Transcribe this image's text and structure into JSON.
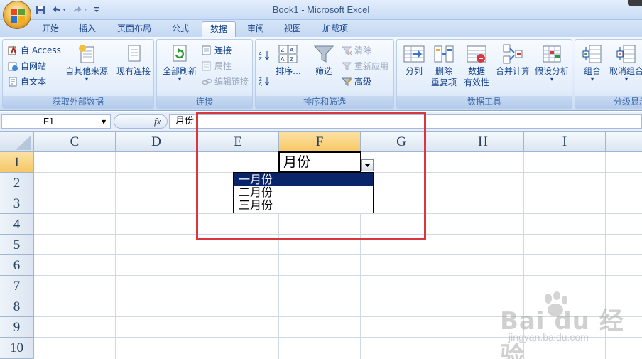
{
  "window": {
    "title": "Book1 - Microsoft Excel"
  },
  "tabs": [
    {
      "label": "开始",
      "active": false
    },
    {
      "label": "插入",
      "active": false
    },
    {
      "label": "页面布局",
      "active": false
    },
    {
      "label": "公式",
      "active": false
    },
    {
      "label": "数据",
      "active": true
    },
    {
      "label": "审阅",
      "active": false
    },
    {
      "label": "视图",
      "active": false
    },
    {
      "label": "加载项",
      "active": false
    }
  ],
  "ribbon": {
    "external_data": {
      "label": "获取外部数据",
      "access": "自 Access",
      "web": "自网站",
      "text": "自文本",
      "other": "自其他来源",
      "existing": "现有连接"
    },
    "connections": {
      "label": "连接",
      "refresh_all": "全部刷新",
      "connections": "连接",
      "properties": "属性",
      "edit_links": "编辑链接"
    },
    "sort_filter": {
      "label": "排序和筛选",
      "sort": "排序...",
      "filter": "筛选",
      "clear": "清除",
      "reapply": "重新应用",
      "advanced": "高级"
    },
    "data_tools": {
      "label": "数据工具",
      "text_to_columns": "分列",
      "remove_dup_1": "删除",
      "remove_dup_2": "重复项",
      "validation_1": "数据",
      "validation_2": "有效性",
      "consolidate": "合并计算",
      "what_if": "假设分析"
    },
    "outline": {
      "label": "分级显示",
      "group": "组合",
      "ungroup": "取消组合"
    }
  },
  "formula_bar": {
    "name_box": "F1",
    "fx": "fx",
    "content": "月份"
  },
  "grid": {
    "columns": [
      "C",
      "D",
      "E",
      "F",
      "G",
      "H",
      "I"
    ],
    "selected_column": "F",
    "rows": [
      "1",
      "2",
      "3",
      "4",
      "5",
      "6",
      "7",
      "8",
      "9",
      "10"
    ],
    "selected_row": "1",
    "active_cell_value": "月份"
  },
  "dropdown": {
    "options": [
      "一月份",
      "二月份",
      "三月份"
    ],
    "selected_index": 0
  },
  "colors": {
    "highlight_box": "#d9373f",
    "selected_option_bg": "#0a246a",
    "selected_header": "#f8c765"
  },
  "watermark": {
    "brand": "Bai du 经验",
    "url": "jingyan.baidu.com"
  }
}
